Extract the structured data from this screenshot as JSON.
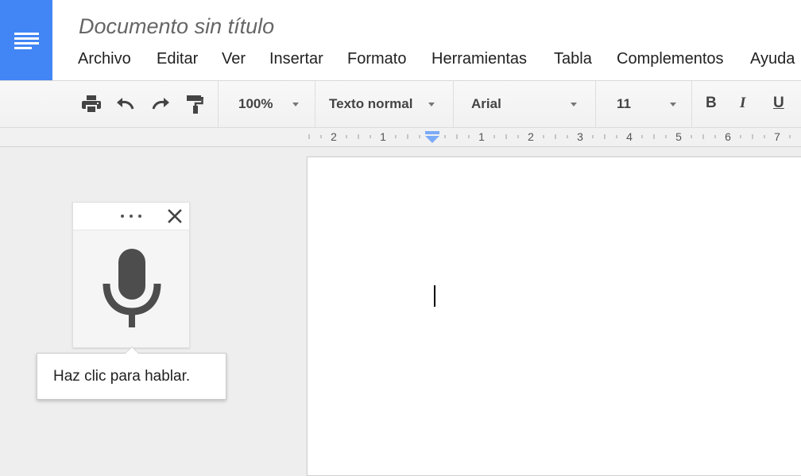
{
  "app": {
    "document_title": "Documento sin título",
    "brand_color": "#4285f4",
    "app_icon": "docs-icon"
  },
  "menu": {
    "items": [
      "Archivo",
      "Editar",
      "Ver",
      "Insertar",
      "Formato",
      "Herramientas",
      "Tabla",
      "Complementos",
      "Ayuda"
    ]
  },
  "toolbar": {
    "icons": [
      "print-icon",
      "undo-icon",
      "redo-icon",
      "paint-format-icon"
    ],
    "zoom": "100%",
    "style": "Texto normal",
    "font": "Arial",
    "font_size": "11",
    "bold_label": "B",
    "italic_label": "I",
    "underline_label": "U"
  },
  "ruler": {
    "labels": [
      "2",
      "1",
      "1",
      "2",
      "3",
      "4",
      "5",
      "6",
      "7"
    ],
    "indent_marker_color": "#7baaf7"
  },
  "voice_typing": {
    "icons": [
      "more-icon",
      "close-icon",
      "microphone-icon"
    ],
    "tooltip": "Haz clic para hablar."
  }
}
